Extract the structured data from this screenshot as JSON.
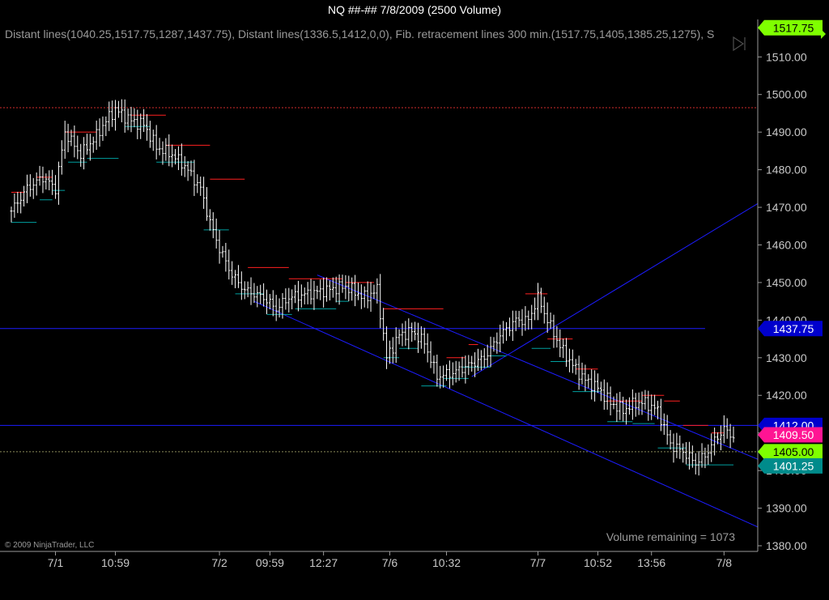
{
  "window": {
    "title": "NQ ##-##  7/8/2009 (2500 Volume)"
  },
  "chart_data": {
    "type": "candlestick",
    "instrument": "NQ ##-##",
    "period": "2500 Volume",
    "indicators_label": "Distant lines(1040.25,1517.75,1287,1437.75), Distant lines(1336.5,1412,0,0), Fib. retracement lines 300 min.(1517.75,1405,1385.25,1275), S",
    "copyright": "© 2009 NinjaTrader, LLC",
    "status_text": "Volume remaining = 1073",
    "ylim": [
      1380,
      1518
    ],
    "y_ticks": [
      1380,
      1390,
      1400,
      1410,
      1420,
      1430,
      1440,
      1450,
      1460,
      1470,
      1480,
      1490,
      1500,
      1510
    ],
    "y_tick_labels": [
      "1380.00",
      "1390.00",
      "1400.00",
      "1410.00",
      "1420.00",
      "1430.00",
      "1440.00",
      "1450.00",
      "1460.00",
      "1470.00",
      "1480.00",
      "1490.00",
      "1500.00",
      "1510.00"
    ],
    "x_tick_labels": [
      {
        "label": "7/1",
        "bar": 14
      },
      {
        "label": "10:59",
        "bar": 33
      },
      {
        "label": "7/2",
        "bar": 66
      },
      {
        "label": "09:59",
        "bar": 82
      },
      {
        "label": "12:27",
        "bar": 99
      },
      {
        "label": "7/6",
        "bar": 120
      },
      {
        "label": "10:32",
        "bar": 138
      },
      {
        "label": "7/7",
        "bar": 167
      },
      {
        "label": "10:52",
        "bar": 186
      },
      {
        "label": "13:56",
        "bar": 203
      },
      {
        "label": "7/8",
        "bar": 226
      }
    ],
    "bar_count": 230,
    "price_path": [
      [
        0,
        1469
      ],
      [
        5,
        1475
      ],
      [
        10,
        1478
      ],
      [
        14,
        1475
      ],
      [
        17,
        1490
      ],
      [
        22,
        1484
      ],
      [
        27,
        1489
      ],
      [
        30,
        1493
      ],
      [
        33,
        1496
      ],
      [
        38,
        1493
      ],
      [
        42,
        1492
      ],
      [
        46,
        1486
      ],
      [
        51,
        1484
      ],
      [
        55,
        1481
      ],
      [
        60,
        1475
      ],
      [
        63,
        1466
      ],
      [
        66,
        1459
      ],
      [
        70,
        1452
      ],
      [
        74,
        1448
      ],
      [
        80,
        1446
      ],
      [
        84,
        1443
      ],
      [
        88,
        1446
      ],
      [
        94,
        1447
      ],
      [
        100,
        1448
      ],
      [
        106,
        1449
      ],
      [
        112,
        1446
      ],
      [
        116,
        1448
      ],
      [
        119,
        1430
      ],
      [
        123,
        1436
      ],
      [
        127,
        1437
      ],
      [
        131,
        1434
      ],
      [
        135,
        1425
      ],
      [
        140,
        1426
      ],
      [
        145,
        1428
      ],
      [
        150,
        1430
      ],
      [
        155,
        1436
      ],
      [
        160,
        1440
      ],
      [
        164,
        1440
      ],
      [
        167,
        1446
      ],
      [
        170,
        1440
      ],
      [
        174,
        1433
      ],
      [
        178,
        1428
      ],
      [
        182,
        1424
      ],
      [
        186,
        1422
      ],
      [
        190,
        1418
      ],
      [
        194,
        1416
      ],
      [
        198,
        1418
      ],
      [
        201,
        1418
      ],
      [
        205,
        1416
      ],
      [
        209,
        1407
      ],
      [
        213,
        1405
      ],
      [
        217,
        1402
      ],
      [
        220,
        1404
      ],
      [
        223,
        1408
      ],
      [
        226,
        1411
      ],
      [
        229,
        1409
      ]
    ],
    "price_markers": [
      {
        "value": 1517.75,
        "label": "1517.75",
        "color": "#7fff00",
        "text_color": "#000000"
      },
      {
        "value": 1437.75,
        "label": "1437.75",
        "color": "#0000cd",
        "text_color": "#ffffff"
      },
      {
        "value": 1412.0,
        "label": "1412.00",
        "color": "#0000cd",
        "text_color": "#ffffff"
      },
      {
        "value": 1409.5,
        "label": "1409.50",
        "color": "#ff1493",
        "text_color": "#ffffff"
      },
      {
        "value": 1405.0,
        "label": "1405.00",
        "color": "#7fff00",
        "text_color": "#000000"
      },
      {
        "value": 1401.25,
        "label": "1401.25",
        "color": "#008b8b",
        "text_color": "#ffffff"
      }
    ],
    "horizontal_lines": [
      {
        "value": 1496.5,
        "color": "#d22b2b",
        "style": "dotted",
        "to_bar": 229
      },
      {
        "value": 1437.75,
        "color": "#1c1cff",
        "style": "solid",
        "to_bar": 220
      },
      {
        "value": 1412.0,
        "color": "#1c1cff",
        "style": "solid",
        "to_bar": 229
      },
      {
        "value": 1405.0,
        "color": "#8a8a5a",
        "style": "dotted",
        "to_bar": 229
      }
    ],
    "trend_lines": [
      {
        "from": [
          146,
          1425
        ],
        "to_edge": 1471,
        "color": "#1c1cff"
      },
      {
        "from": [
          77,
          1445
        ],
        "to_edge": 1385,
        "color": "#1c1cff"
      },
      {
        "from": [
          97,
          1452
        ],
        "to_edge": 1403,
        "color": "#1c1cff"
      }
    ],
    "pivot_highs": [
      [
        [
          0,
          4
        ],
        1474
      ],
      [
        [
          8,
          13
        ],
        1478
      ],
      [
        [
          17,
          27
        ],
        1490
      ],
      [
        [
          38,
          49
        ],
        1494.5
      ],
      [
        [
          49,
          63
        ],
        1486.5
      ],
      [
        [
          63,
          74
        ],
        1477.5
      ],
      [
        [
          75,
          88
        ],
        1454
      ],
      [
        [
          88,
          105
        ],
        1451
      ],
      [
        [
          106,
          115
        ],
        1450
      ],
      [
        [
          118,
          137
        ],
        1443
      ],
      [
        [
          138,
          144
        ],
        1430
      ],
      [
        [
          145,
          148
        ],
        1433.5
      ],
      [
        [
          163,
          170
        ],
        1447
      ],
      [
        [
          170,
          178
        ],
        1435
      ],
      [
        [
          179,
          186
        ],
        1427
      ],
      [
        [
          189,
          200
        ],
        1418.5
      ],
      [
        [
          200,
          207
        ],
        1420
      ],
      [
        [
          207,
          212
        ],
        1418.5
      ],
      [
        [
          213,
          221
        ],
        1412
      ],
      [
        [
          222,
          226
        ],
        1410
      ]
    ],
    "pivot_lows": [
      [
        [
          0,
          8
        ],
        1466
      ],
      [
        [
          9,
          13
        ],
        1472
      ],
      [
        [
          13,
          17
        ],
        1474.5
      ],
      [
        [
          18,
          24
        ],
        1482
      ],
      [
        [
          24,
          34
        ],
        1483
      ],
      [
        [
          36,
          44
        ],
        1491.5
      ],
      [
        [
          46,
          58
        ],
        1482
      ],
      [
        [
          61,
          69
        ],
        1464
      ],
      [
        [
          71,
          80
        ],
        1447
      ],
      [
        [
          81,
          89
        ],
        1441.5
      ],
      [
        [
          90,
          103
        ],
        1443
      ],
      [
        [
          103,
          107
        ],
        1445
      ],
      [
        [
          118,
          123
        ],
        1430
      ],
      [
        [
          123,
          129
        ],
        1432.5
      ],
      [
        [
          130,
          138
        ],
        1422.5
      ],
      [
        [
          137,
          145
        ],
        1424.5
      ],
      [
        [
          143,
          152
        ],
        1427.5
      ],
      [
        [
          152,
          157
        ],
        1430.5
      ],
      [
        [
          165,
          171
        ],
        1432.5
      ],
      [
        [
          171,
          176
        ],
        1429
      ],
      [
        [
          178,
          187
        ],
        1421
      ],
      [
        [
          189,
          197
        ],
        1413
      ],
      [
        [
          197,
          204
        ],
        1412.5
      ],
      [
        [
          205,
          214
        ],
        1406
      ],
      [
        [
          214,
          222
        ],
        1401.5
      ],
      [
        [
          222,
          229
        ],
        1401.5
      ]
    ],
    "colors": {
      "background": "#000000",
      "axis": "#9a9a9a",
      "text": "#c8c8c8",
      "bars": "#ffffff",
      "pivot_high": "#ff2020",
      "pivot_low": "#00a0a0"
    }
  }
}
